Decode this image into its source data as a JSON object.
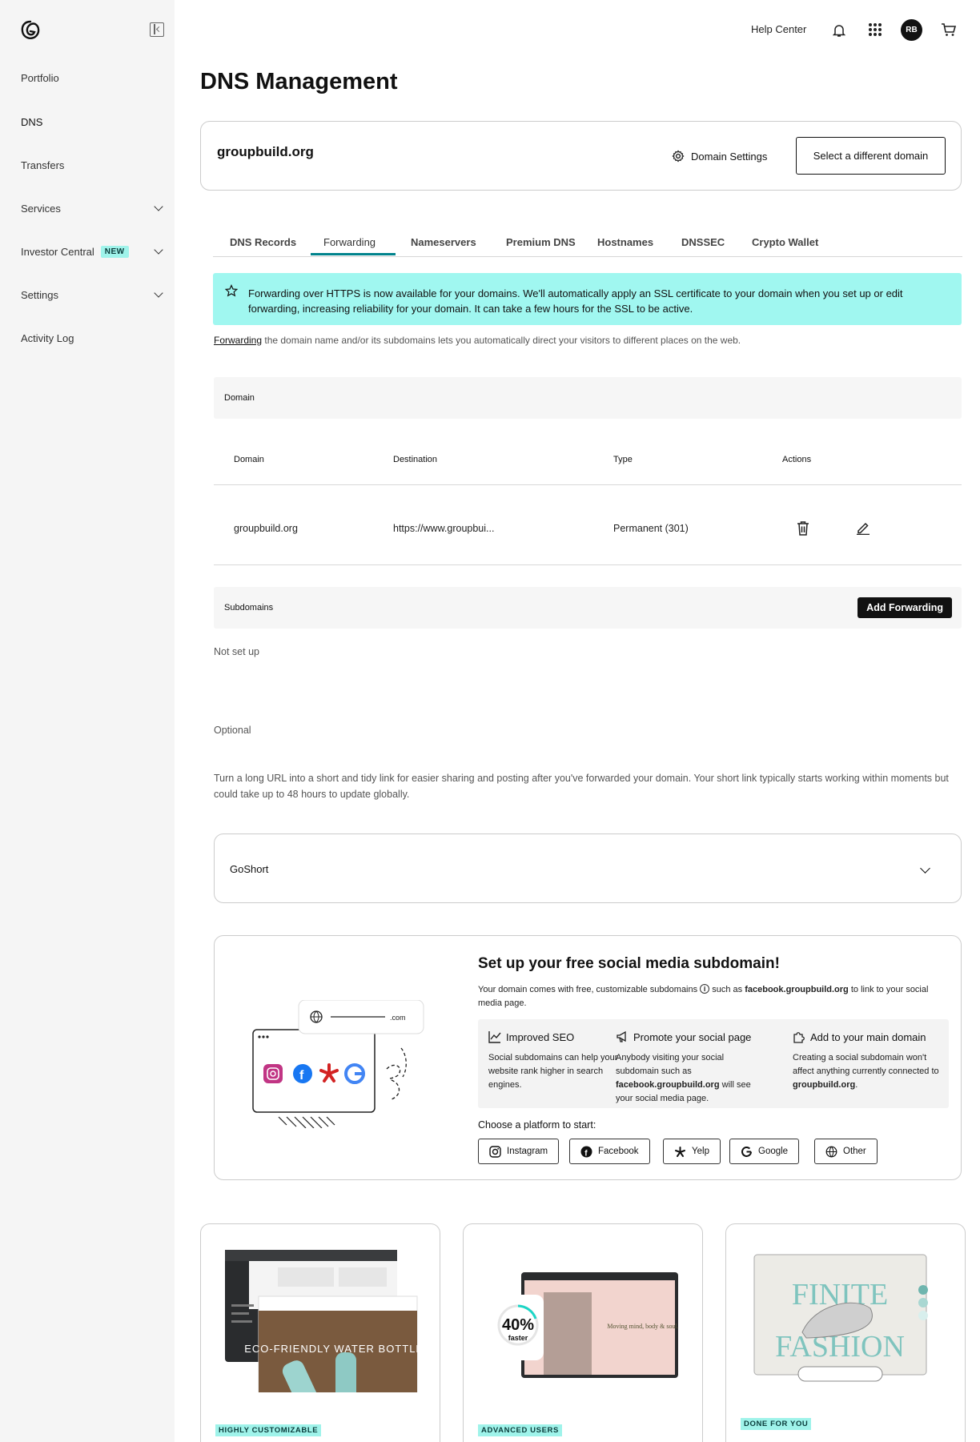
{
  "sidebar": {
    "items": [
      {
        "label": "Portfolio"
      },
      {
        "label": "DNS"
      },
      {
        "label": "Transfers"
      },
      {
        "label": "Services"
      },
      {
        "label": "Investor Central",
        "badge": "NEW"
      },
      {
        "label": "Settings"
      },
      {
        "label": "Activity Log"
      }
    ]
  },
  "topbar": {
    "help": "Help Center",
    "avatar_initials": "RB"
  },
  "page": {
    "title": "DNS Management"
  },
  "domain_card": {
    "name": "groupbuild.org",
    "settings_label": "Domain Settings",
    "select_label": "Select a different domain"
  },
  "tabs": [
    "DNS Records",
    "Forwarding",
    "Nameservers",
    "Premium DNS",
    "Hostnames",
    "DNSSEC",
    "Crypto Wallet"
  ],
  "alert": {
    "text": "Forwarding over HTTPS is now available for your domains. We'll automatically apply an SSL certificate to your domain when you set up or edit forwarding, increasing reliability for your domain. It can take a few hours for the SSL to be active."
  },
  "info": {
    "link": "Forwarding",
    "rest": " the domain name and/or its subdomains lets you automatically direct your visitors to different places on the web."
  },
  "domain_section": {
    "title": "Domain",
    "columns": [
      "Domain",
      "Destination",
      "Type",
      "Actions"
    ],
    "rows": [
      {
        "domain": "groupbuild.org",
        "destination": "https://www.groupbui...",
        "type": "Permanent (301)"
      }
    ]
  },
  "subdomains": {
    "title": "Subdomains",
    "add_label": "Add Forwarding",
    "empty": "Not set up"
  },
  "optional": {
    "label": "Optional",
    "desc": "Turn a long URL into a short and tidy link for easier sharing and posting after you've forwarded your domain. Your short link typically starts working within moments but could take up to 48 hours to update globally.",
    "goshort": "GoShort"
  },
  "social": {
    "title": "Set up your free social media subdomain!",
    "desc_1": "Your domain comes with free, customizable subdomains",
    "desc_2": " such as ",
    "desc_bold": "facebook.groupbuild.org",
    "desc_3": " to link to your social media page.",
    "illus_domain": ".com",
    "benefits": [
      {
        "title": "Improved SEO",
        "desc": "Social subdomains can help your website rank higher in search engines."
      },
      {
        "title": "Promote your social page",
        "desc_a": "Anybody visiting your social subdomain such as ",
        "desc_b": "facebook.groupbuild.org",
        "desc_c": " will see your social media page."
      },
      {
        "title": "Add to your main domain",
        "desc_a": "Creating a social subdomain won't affect anything currently connected to ",
        "desc_b": "groupbuild.org",
        "desc_c": "."
      }
    ],
    "choose": "Choose a platform to start:",
    "platforms": [
      "Instagram",
      "Facebook",
      "Yelp",
      "Google",
      "Other"
    ]
  },
  "promos": [
    {
      "tag": "HIGHLY CUSTOMIZABLE",
      "image_text": "ECO-FRIENDLY WATER BOTTLES"
    },
    {
      "tag": "ADVANCED USERS",
      "badge_value": "40%",
      "badge_sub": "faster",
      "image_text": "Moving mind, body & soul."
    },
    {
      "tag": "DONE FOR YOU",
      "image_text_1": "FINITE",
      "image_text_2": "FASHION"
    }
  ],
  "colors": {
    "accent": "#00838c",
    "alert_bg": "#a0f7f0",
    "badge_bg": "#9ff3ea"
  }
}
